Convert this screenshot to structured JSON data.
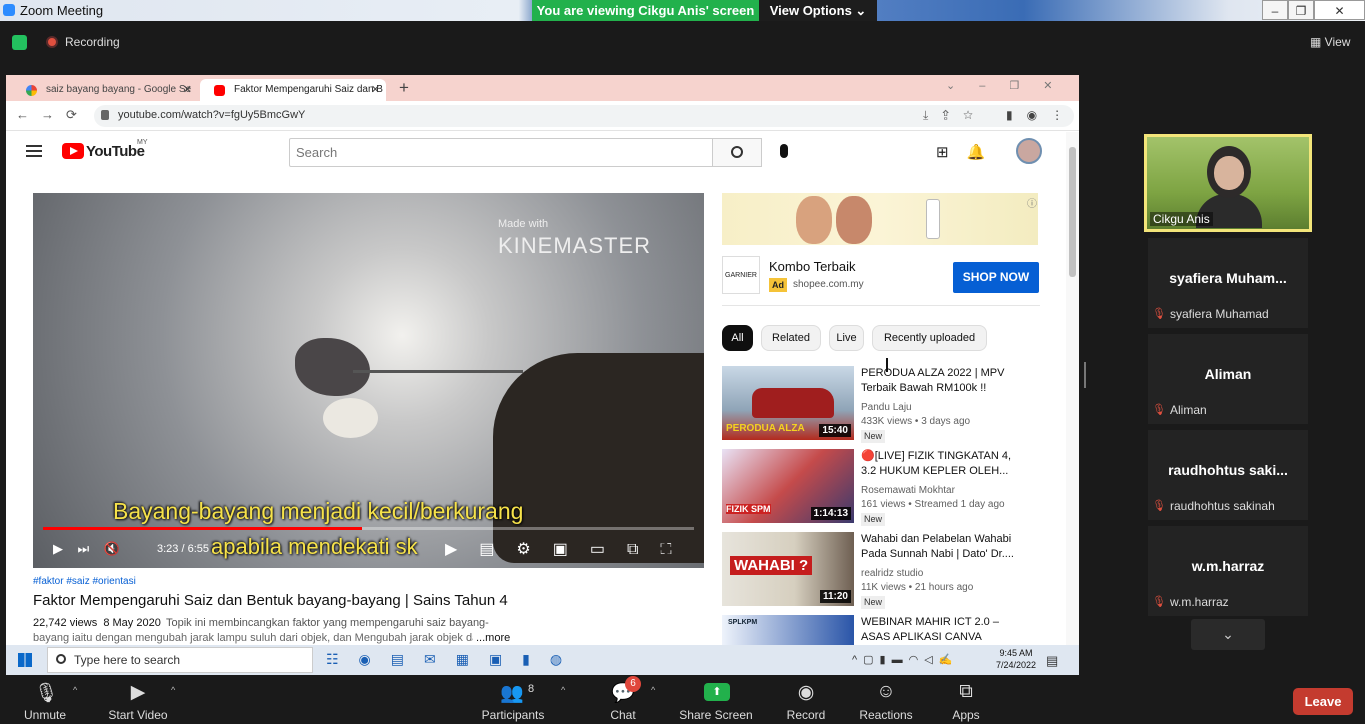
{
  "window": {
    "title": "Zoom Meeting",
    "viewing": "You are viewing Cikgu Anis' screen",
    "view_options": "View Options"
  },
  "topbar": {
    "recording": "Recording",
    "view": "View"
  },
  "browser": {
    "tabs": [
      {
        "label": "saiz bayang bayang - Google Se"
      },
      {
        "label": "Faktor Mempengaruhi Saiz dan B"
      }
    ],
    "url": "youtube.com/watch?v=fgUy5BmcGwY"
  },
  "youtube": {
    "logo": "YouTube",
    "region": "MY",
    "search_placeholder": "Search",
    "video": {
      "watermark_small": "Made with",
      "watermark": "KINEMASTER",
      "subtitle1": "Bayang-bayang menjadi kecil/berkurang",
      "subtitle2": "apabila mendekati sk",
      "time": "3:23 / 6:55",
      "progress_fraction": 0.49
    },
    "tags": "#faktor #saiz #orientasi",
    "title": "Faktor Mempengaruhi Saiz dan Bentuk bayang-bayang | Sains Tahun 4",
    "views": "22,742 views",
    "date": "8 May 2020",
    "desc1": "Topik ini membincangkan faktor yang mempengaruhi saiz bayang-",
    "desc2": "bayang iaitu dengan mengubah jarak lampu suluh dari objek, dan Mengubah jarak objek da",
    "more": "...more",
    "ad": {
      "logo": "GARNIER",
      "title": "Kombo Terbaik",
      "badge": "Ad",
      "site": "shopee.com.my",
      "cta": "SHOP NOW"
    },
    "chips": [
      "All",
      "Related",
      "Live",
      "Recently uploaded"
    ],
    "recommendations": [
      {
        "title": "PERODUA ALZA 2022 | MPV Terbaik Bawah RM100k !!",
        "channel": "Pandu Laju",
        "meta": "433K views • 3 days ago",
        "badge": "New",
        "duration": "15:40",
        "thumb_text": "PERODUA ALZA"
      },
      {
        "title": "🔴[LIVE] FIZIK TINGKATAN 4, 3.2 HUKUM KEPLER OLEH...",
        "channel": "Rosemawati Mokhtar",
        "meta": "161 views • Streamed 1 day ago",
        "badge": "New",
        "duration": "1:14:13",
        "thumb_text": "FIZIK SPM"
      },
      {
        "title": "Wahabi dan Pelabelan Wahabi Pada Sunnah Nabi | Dato' Dr....",
        "channel": "realridz studio",
        "meta": "11K views • 21 hours ago",
        "badge": "New",
        "duration": "11:20",
        "thumb_text": "WAHABI ?"
      },
      {
        "title": "WEBINAR MAHIR ICT 2.0 – ASAS APLIKASI CANVA",
        "channel": "",
        "meta": "",
        "badge": "",
        "duration": "",
        "thumb_text": "SPLKPM"
      }
    ]
  },
  "taskbar": {
    "search": "Type here to search",
    "time": "9:45 AM",
    "date": "7/24/2022"
  },
  "participants": [
    {
      "name": "Cikgu Anis"
    },
    {
      "display": "syafiera  Muham...",
      "label": "syafiera Muhamad"
    },
    {
      "display": "Aliman",
      "label": "Aliman"
    },
    {
      "display": "raudhohtus  saki...",
      "label": "raudhohtus sakinah"
    },
    {
      "display": "w.m.harraz",
      "label": "w.m.harraz"
    }
  ],
  "toolbar": {
    "unmute": "Unmute",
    "start_video": "Start Video",
    "participants": "Participants",
    "participant_count": "8",
    "chat": "Chat",
    "chat_badge": "6",
    "share": "Share Screen",
    "record": "Record",
    "reactions": "Reactions",
    "apps": "Apps",
    "leave": "Leave"
  }
}
